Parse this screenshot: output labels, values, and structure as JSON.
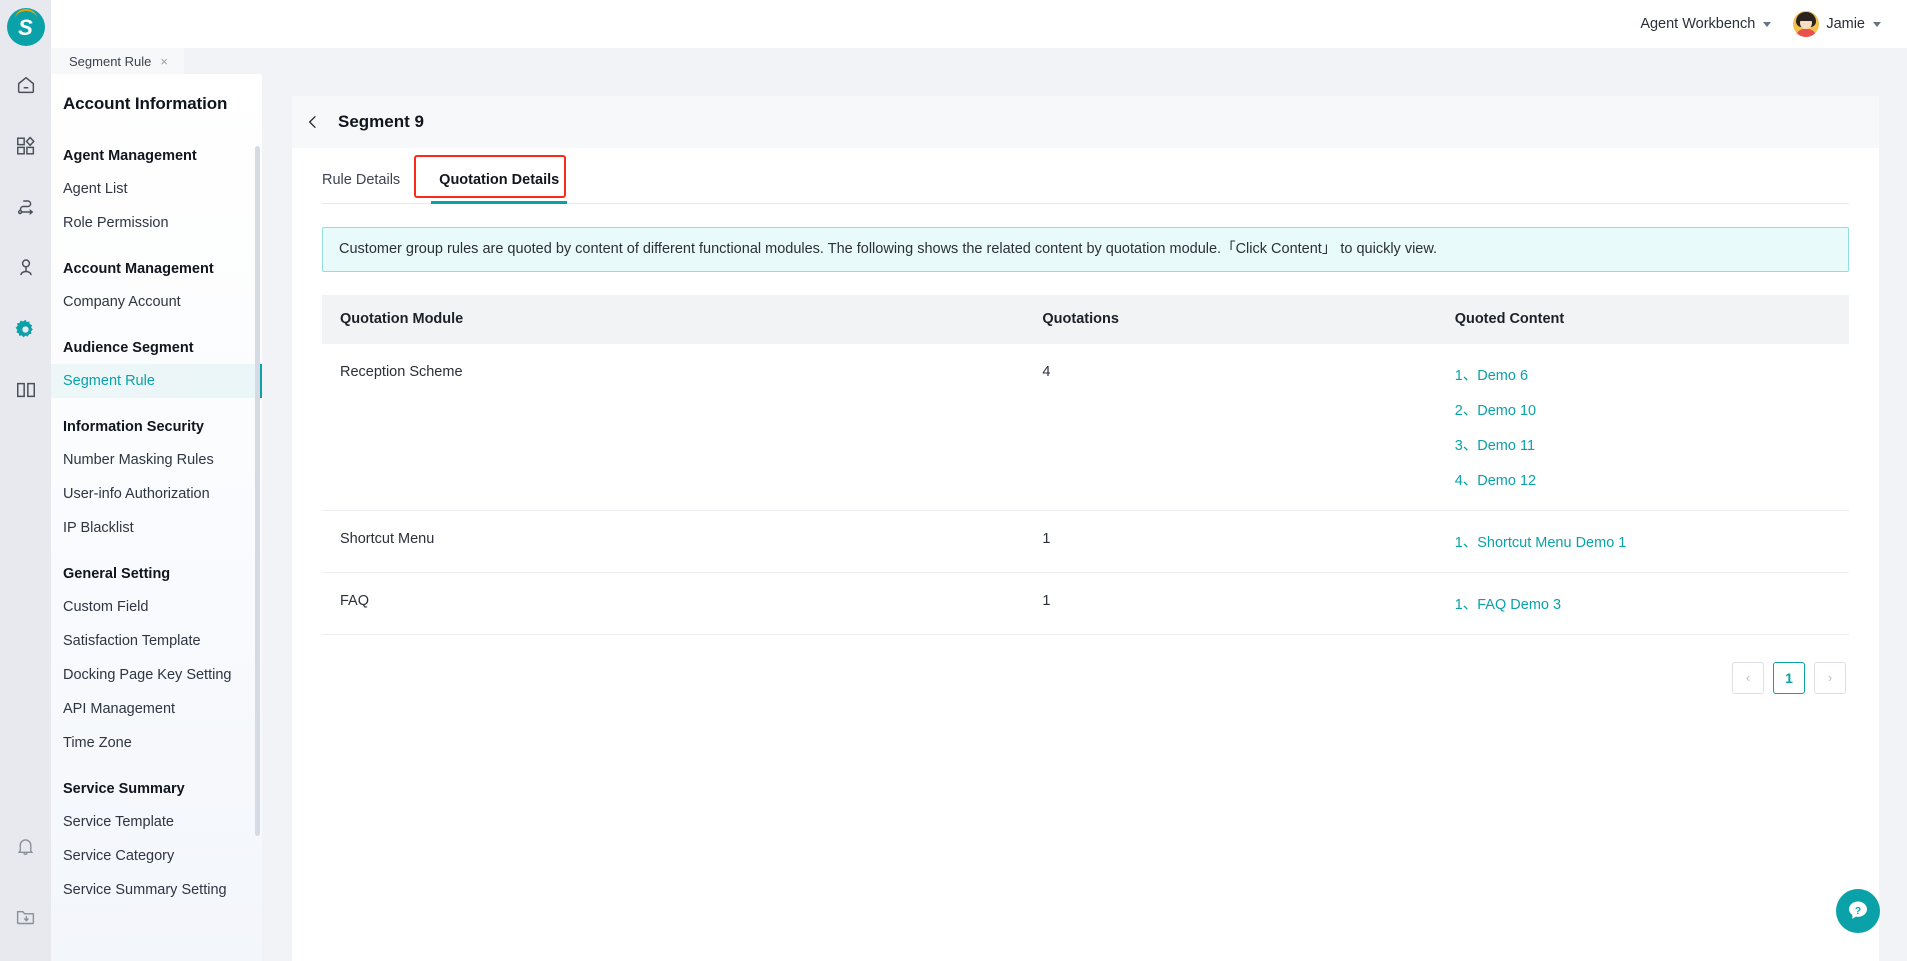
{
  "brand": {
    "logo_letter": "S",
    "accent_color": "#0aa2a8",
    "highlight_color": "#fb2b1c"
  },
  "rail": {
    "items": [
      {
        "icon": "home-icon",
        "active": false
      },
      {
        "icon": "apps-grid-icon",
        "active": false
      },
      {
        "icon": "flow-route-icon",
        "active": false
      },
      {
        "icon": "contact-person-icon",
        "active": false
      },
      {
        "icon": "gear-icon",
        "active": true
      },
      {
        "icon": "book-icon",
        "active": false
      }
    ],
    "bottom_items": [
      {
        "icon": "bell-icon"
      },
      {
        "icon": "folder-download-icon"
      }
    ]
  },
  "topbar": {
    "workspace": "Agent Workbench",
    "user": "Jamie"
  },
  "doc_tabs": [
    {
      "label": "Segment Rule",
      "close": "×",
      "active": true
    }
  ],
  "sidebar": {
    "title": "Account Information",
    "groups": [
      {
        "title": "Agent Management",
        "items": [
          {
            "label": "Agent List",
            "active": false
          },
          {
            "label": "Role Permission",
            "active": false
          }
        ]
      },
      {
        "title": "Account Management",
        "items": [
          {
            "label": "Company Account",
            "active": false
          }
        ]
      },
      {
        "title": "Audience Segment",
        "items": [
          {
            "label": "Segment Rule",
            "active": true
          }
        ]
      },
      {
        "title": "Information Security",
        "items": [
          {
            "label": "Number Masking Rules",
            "active": false
          },
          {
            "label": "User-info Authorization",
            "active": false
          },
          {
            "label": "IP Blacklist",
            "active": false
          }
        ]
      },
      {
        "title": "General Setting",
        "items": [
          {
            "label": "Custom Field",
            "active": false
          },
          {
            "label": "Satisfaction Template",
            "active": false
          },
          {
            "label": "Docking Page Key Setting",
            "active": false
          },
          {
            "label": "API Management",
            "active": false
          },
          {
            "label": "Time Zone",
            "active": false
          }
        ]
      },
      {
        "title": "Service Summary",
        "items": [
          {
            "label": "Service Template",
            "active": false
          },
          {
            "label": "Service Category",
            "active": false
          },
          {
            "label": "Service Summary Setting",
            "active": false
          }
        ]
      }
    ]
  },
  "page": {
    "title": "Segment 9",
    "back_icon": "chevron-left-icon",
    "tabs": [
      {
        "label": "Rule Details",
        "active": false
      },
      {
        "label": "Quotation Details",
        "active": true,
        "highlighted": true
      }
    ],
    "notice": "Customer group rules are quoted by content of different functional modules. The following shows the related content by quotation module.「Click Content」 to quickly view.",
    "table": {
      "columns": [
        "Quotation Module",
        "Quotations",
        "Quoted Content"
      ],
      "rows": [
        {
          "module": "Reception Scheme",
          "quotations": "4",
          "content": [
            "1、Demo 6",
            "2、Demo 10",
            "3、Demo 11",
            "4、Demo 12"
          ]
        },
        {
          "module": "Shortcut Menu",
          "quotations": "1",
          "content": [
            "1、Shortcut Menu Demo 1"
          ]
        },
        {
          "module": "FAQ",
          "quotations": "1",
          "content": [
            "1、FAQ Demo 3"
          ]
        }
      ]
    },
    "pagination": {
      "prev": "‹",
      "pages": [
        "1"
      ],
      "next": "›",
      "current": "1"
    }
  },
  "help": {
    "icon": "help-chat-icon"
  }
}
